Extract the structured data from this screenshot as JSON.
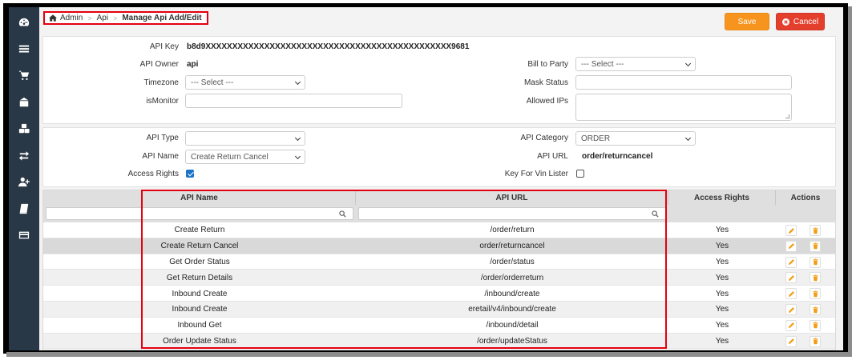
{
  "colors": {
    "accent_save": "#f7941d",
    "accent_cancel": "#e33f2c",
    "sidebar": "#293846",
    "highlight": "#e3000f"
  },
  "sidebar": {
    "items": [
      {
        "icon": "dashboard-icon"
      },
      {
        "icon": "list-icon"
      },
      {
        "icon": "cart-icon"
      },
      {
        "icon": "inventory-icon"
      },
      {
        "icon": "cubes-icon"
      },
      {
        "icon": "exchange-icon"
      },
      {
        "icon": "user-add-icon"
      },
      {
        "icon": "book-icon"
      },
      {
        "icon": "card-icon"
      }
    ]
  },
  "breadcrumb": {
    "home": "Admin",
    "section": "Api",
    "current": "Manage Api Add/Edit"
  },
  "toolbar": {
    "save_label": "Save",
    "cancel_label": "Cancel"
  },
  "form": {
    "api_key_label": "API Key",
    "api_key_value": "b8d9XXXXXXXXXXXXXXXXXXXXXXXXXXXXXXXXXXXXXXXXXXXXXX9681",
    "api_owner_label": "API Owner",
    "api_owner_value": "api",
    "timezone_label": "Timezone",
    "timezone_value": "--- Select ---",
    "is_monitor_label": "isMonitor",
    "bill_to_party_label": "Bill to Party",
    "bill_to_party_value": "--- Select ---",
    "mask_status_label": "Mask Status",
    "allowed_ips_label": "Allowed IPs",
    "api_type_label": "API Type",
    "api_type_value": "",
    "api_name_label": "API Name",
    "api_name_value": "Create Return Cancel",
    "access_rights_label": "Access Rights",
    "access_rights_checked": true,
    "api_category_label": "API Category",
    "api_category_value": "ORDER",
    "api_url_label": "API URL",
    "api_url_value": "order/returncancel",
    "key_for_vin_lister_label": "Key For Vin Lister",
    "key_for_vin_lister_checked": false
  },
  "table": {
    "columns": [
      "API Name",
      "API URL",
      "Access Rights",
      "Actions"
    ],
    "rows": [
      {
        "name": "Create Return",
        "url": "/order/return",
        "access": "Yes"
      },
      {
        "name": "Create Return Cancel",
        "url": "order/returncancel",
        "access": "Yes"
      },
      {
        "name": "Get Order Status",
        "url": "/order/status",
        "access": "Yes"
      },
      {
        "name": "Get Return Details",
        "url": "/order/orderreturn",
        "access": "Yes"
      },
      {
        "name": "Inbound Create",
        "url": "/inbound/create",
        "access": "Yes"
      },
      {
        "name": "Inbound Create",
        "url": "eretail/v4/inbound/create",
        "access": "Yes"
      },
      {
        "name": "Inbound Get",
        "url": "/inbound/detail",
        "access": "Yes"
      },
      {
        "name": "Order Update Status",
        "url": "/order/updateStatus",
        "access": "Yes"
      }
    ]
  }
}
